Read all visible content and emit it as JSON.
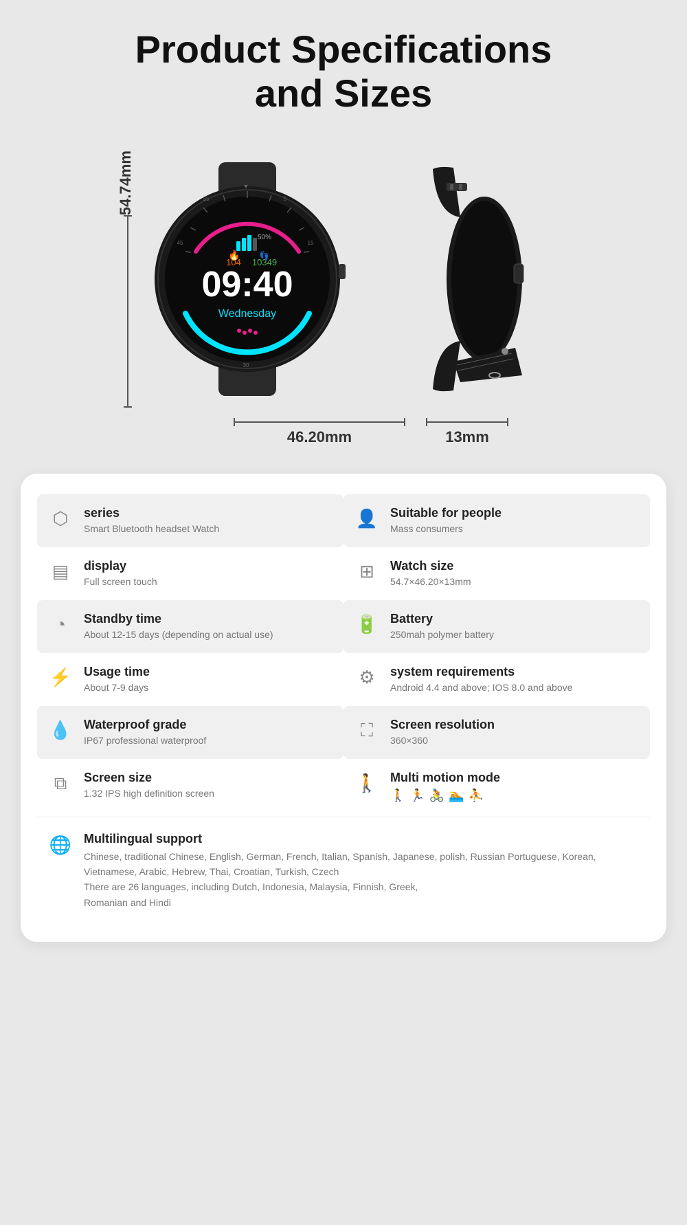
{
  "page": {
    "title_line1": "Product Specifications",
    "title_line2": "and Sizes"
  },
  "dimensions": {
    "height": "54.74mm",
    "width": "46.20mm",
    "depth": "13mm"
  },
  "specs": [
    {
      "row_shaded": true,
      "left": {
        "icon": "series-icon",
        "title": "series",
        "value": "Smart Bluetooth headset Watch"
      },
      "right": {
        "icon": "person-icon",
        "title": "Suitable for people",
        "value": "Mass consumers"
      }
    },
    {
      "row_shaded": false,
      "left": {
        "icon": "display-icon",
        "title": "display",
        "value": "Full screen touch"
      },
      "right": {
        "icon": "watchsize-icon",
        "title": "Watch size",
        "value": "54.7×46.20×13mm"
      }
    },
    {
      "row_shaded": true,
      "left": {
        "icon": "standby-icon",
        "title": "Standby time",
        "value": "About 12-15 days (depending on actual use)"
      },
      "right": {
        "icon": "battery-icon",
        "title": "Battery",
        "value": "250mah polymer battery"
      }
    },
    {
      "row_shaded": false,
      "left": {
        "icon": "usage-icon",
        "title": "Usage time",
        "value": "About 7-9 days"
      },
      "right": {
        "icon": "system-icon",
        "title": "system requirements",
        "value": "Android 4.4 and above; IOS 8.0 and above"
      }
    },
    {
      "row_shaded": true,
      "left": {
        "icon": "waterproof-icon",
        "title": "Waterproof grade",
        "value": "IP67 professional waterproof"
      },
      "right": {
        "icon": "resolution-icon",
        "title": "Screen resolution",
        "value": "360×360"
      }
    },
    {
      "row_shaded": false,
      "left": {
        "icon": "screensize-icon",
        "title": "Screen size",
        "value": "1.32 IPS high definition screen"
      },
      "right": {
        "icon": "motion-icon",
        "title": "Multi motion mode",
        "value": "",
        "has_motion_icons": true
      }
    }
  ],
  "multilingual": {
    "icon": "globe-icon",
    "title": "Multilingual support",
    "value": "Chinese, traditional Chinese, English, German, French, Italian, Spanish, Japanese, polish, Russian Portuguese, Korean, Vietnamese, Arabic, Hebrew, Thai, Croatian, Turkish, Czech\nThere are 26 languages, including Dutch, Indonesia, Malaysia, Finnish, Greek,\nRomanian and Hindi"
  }
}
